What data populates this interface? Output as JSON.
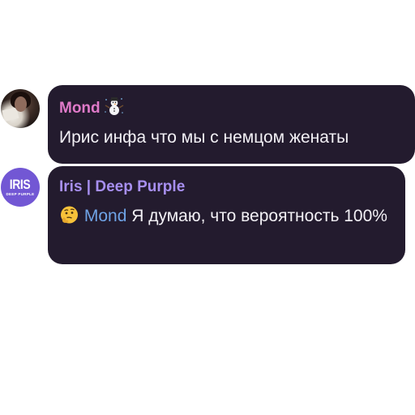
{
  "messages": [
    {
      "sender": "Mond",
      "sender_color": "#e07ac9",
      "sender_emoji_icon": "snowman-icon",
      "avatar_icon": "user-photo-avatar",
      "text": "Ирис инфа что мы с немцом женаты"
    },
    {
      "sender": "Iris | Deep Purple",
      "sender_color": "#a78ff0",
      "avatar": {
        "title": "IRIS",
        "subtitle": "DEEP PURPLE",
        "color": "#7257d4"
      },
      "emoji_icon": "thinking-face-icon",
      "mention": "Mond",
      "mention_color": "#6fa3e6",
      "text": "Я думаю, что вероятность 100%"
    }
  ],
  "colors": {
    "bubble": "#231b2e",
    "text": "#f2f0f5",
    "background": "#ffffff"
  }
}
